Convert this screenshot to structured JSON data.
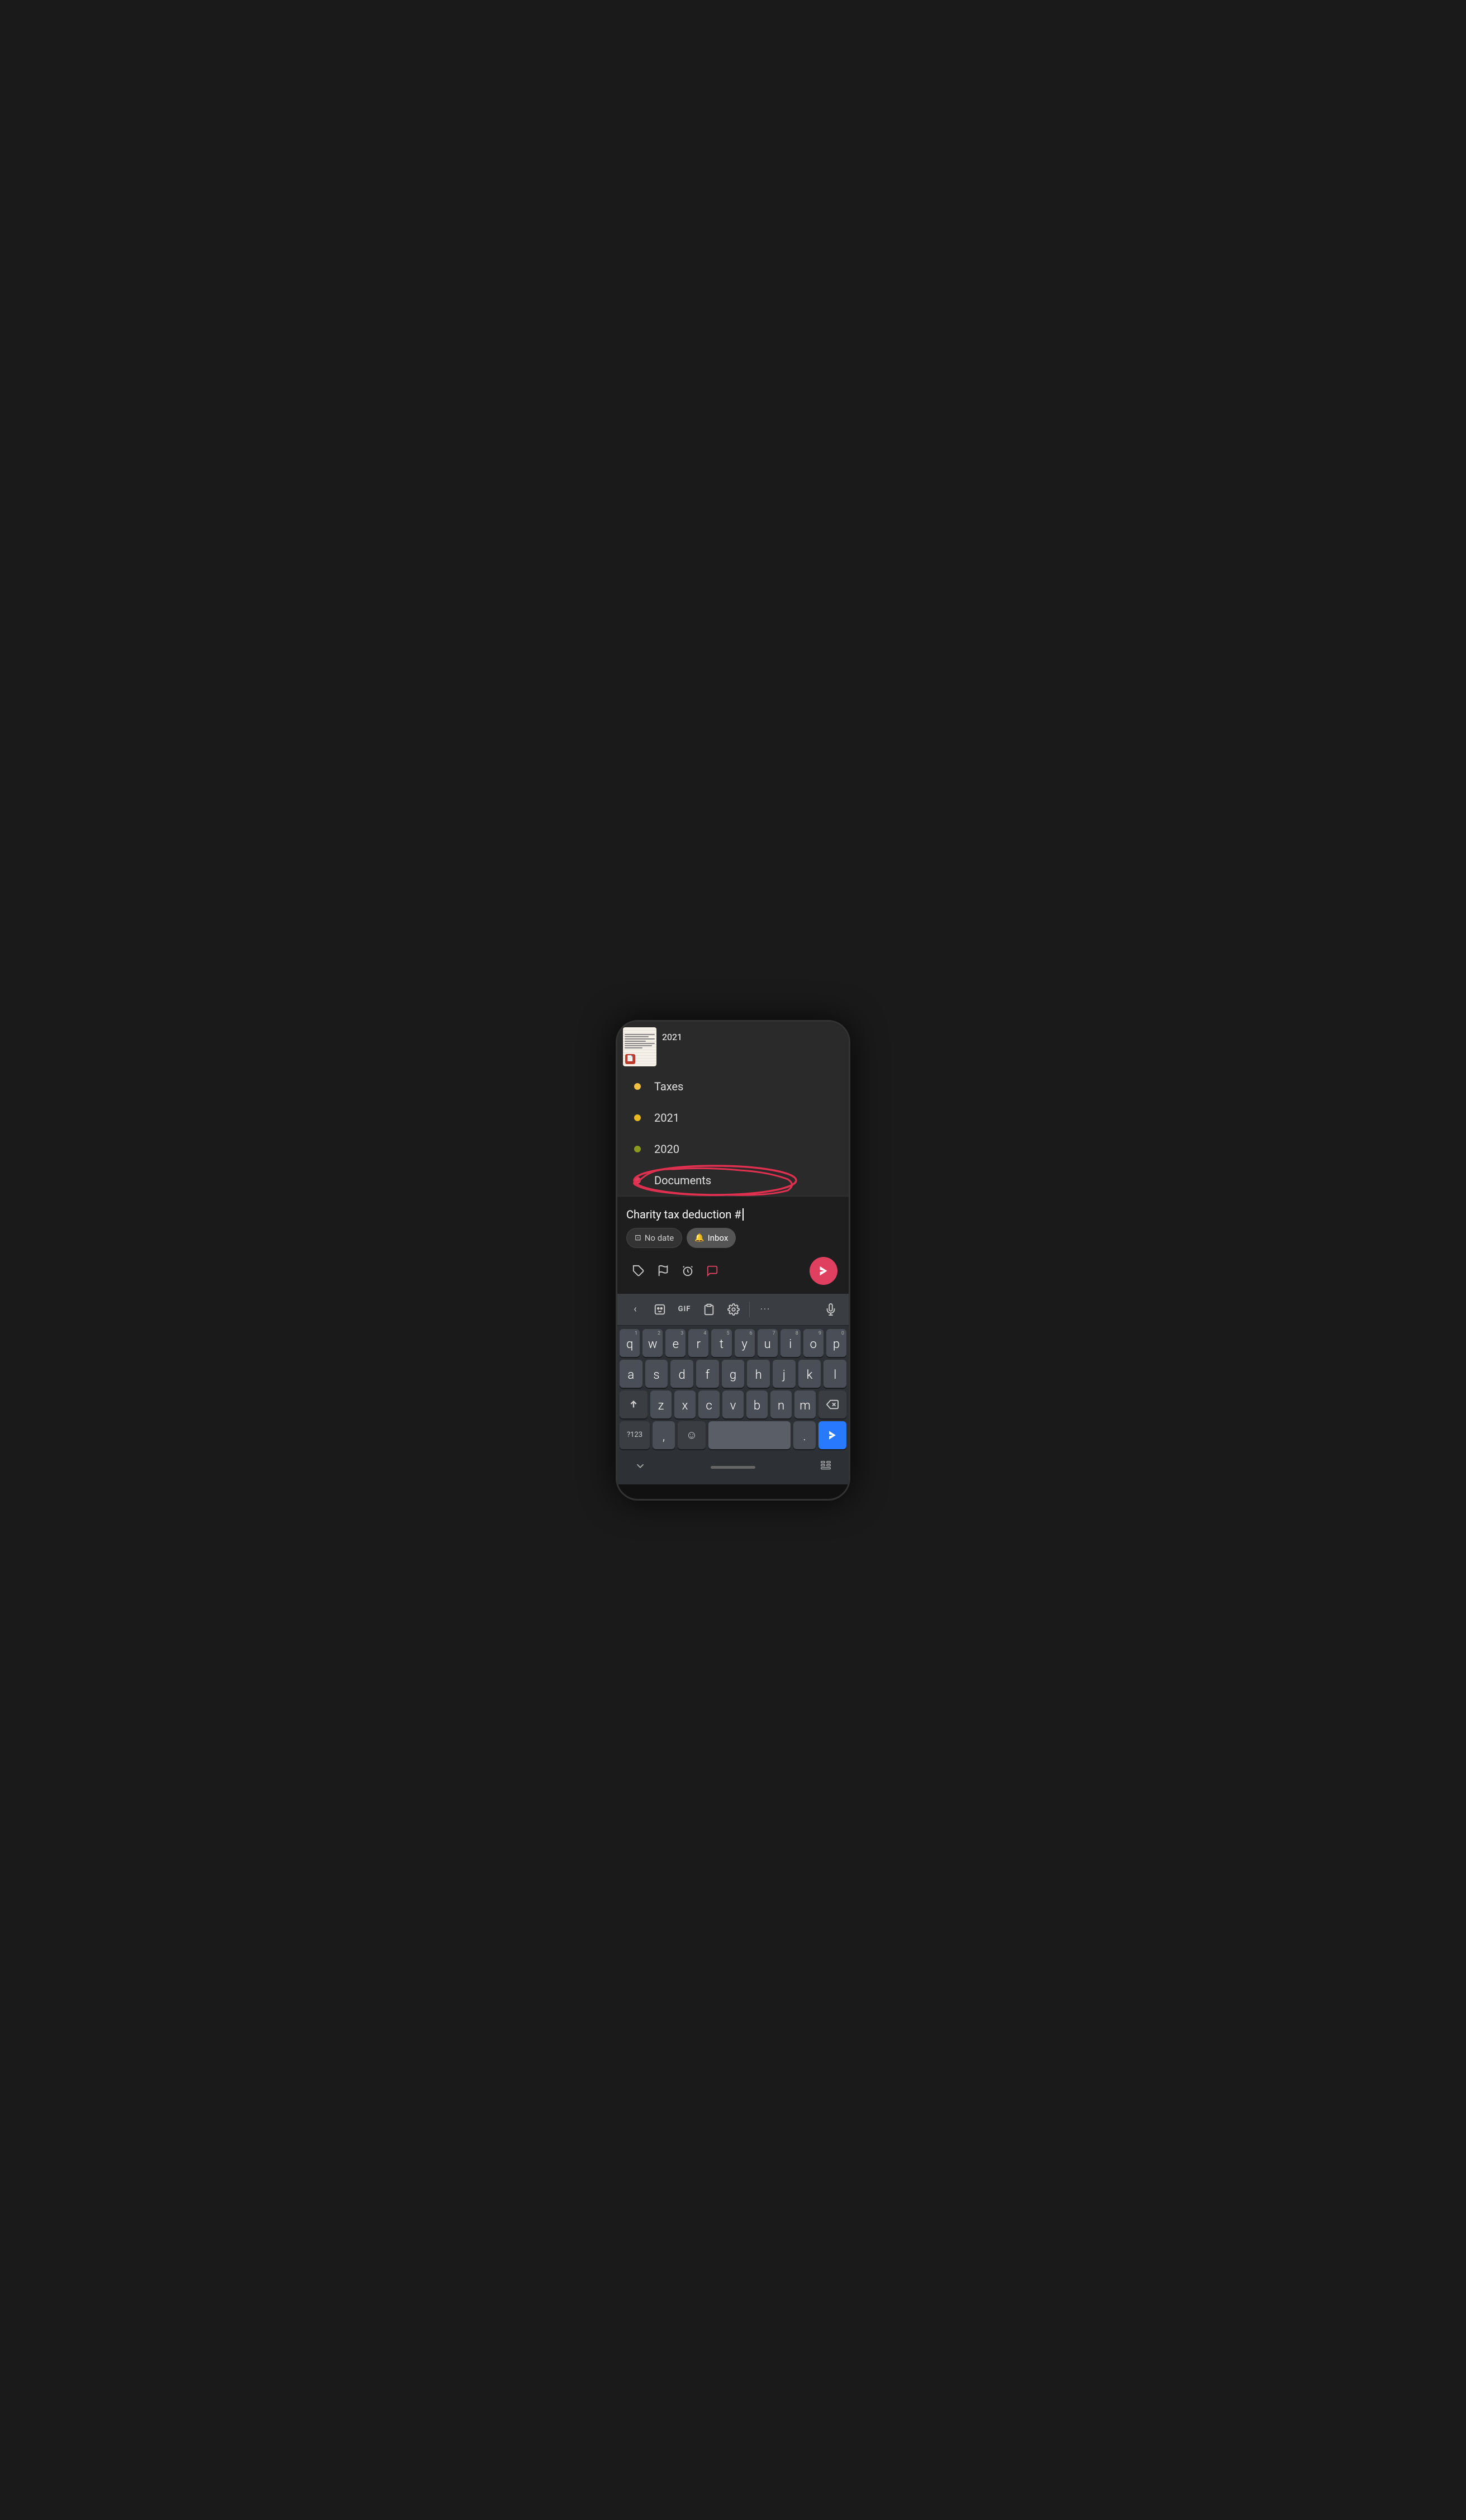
{
  "menu": {
    "items": [
      {
        "id": "taxes",
        "label": "Taxes",
        "dot_color": "yellow"
      },
      {
        "id": "2021",
        "label": "2021",
        "dot_color": "yellow2"
      },
      {
        "id": "2020",
        "label": "2020",
        "dot_color": "olive"
      },
      {
        "id": "documents",
        "label": "Documents",
        "dot_color": "red",
        "circled": true
      }
    ]
  },
  "task_input": {
    "text": "Charity tax deduction #",
    "cursor_visible": true
  },
  "chips": {
    "date_label": "No date",
    "inbox_label": "Inbox"
  },
  "toolbar": {
    "label_label": "label-icon",
    "flag_label": "flag-icon",
    "reminder_label": "reminder-icon",
    "comment_label": "comment-icon",
    "send_label": "send-icon"
  },
  "keyboard_toolbar": {
    "back_label": "<",
    "emoji_label": "emoji-keyboard-icon",
    "gif_label": "GIF",
    "clipboard_label": "clipboard-icon",
    "settings_label": "settings-icon",
    "more_label": "...",
    "mic_label": "mic-icon"
  },
  "keyboard": {
    "rows": [
      {
        "keys": [
          {
            "letter": "q",
            "number": "1"
          },
          {
            "letter": "w",
            "number": "2"
          },
          {
            "letter": "e",
            "number": "3"
          },
          {
            "letter": "r",
            "number": "4"
          },
          {
            "letter": "t",
            "number": "5"
          },
          {
            "letter": "y",
            "number": "6"
          },
          {
            "letter": "u",
            "number": "7"
          },
          {
            "letter": "i",
            "number": "8"
          },
          {
            "letter": "o",
            "number": "9"
          },
          {
            "letter": "p",
            "number": "0"
          }
        ]
      },
      {
        "keys": [
          {
            "letter": "a"
          },
          {
            "letter": "s"
          },
          {
            "letter": "d"
          },
          {
            "letter": "f"
          },
          {
            "letter": "g"
          },
          {
            "letter": "h"
          },
          {
            "letter": "j"
          },
          {
            "letter": "k"
          },
          {
            "letter": "l"
          }
        ]
      },
      {
        "keys": [
          {
            "letter": "⇧",
            "special": true
          },
          {
            "letter": "z"
          },
          {
            "letter": "x"
          },
          {
            "letter": "c"
          },
          {
            "letter": "v"
          },
          {
            "letter": "b"
          },
          {
            "letter": "n"
          },
          {
            "letter": "m"
          },
          {
            "letter": "⌫",
            "special": true
          }
        ]
      },
      {
        "keys": [
          {
            "letter": "?123",
            "special": true
          },
          {
            "letter": ","
          },
          {
            "letter": "☺",
            "special": true
          },
          {
            "letter": " ",
            "space": true
          },
          {
            "letter": ".",
            "special_small": true
          },
          {
            "letter": "▶",
            "send_blue": true
          }
        ]
      }
    ]
  },
  "bottom_bar": {
    "back_icon": "chevron-down",
    "home_pill": "",
    "grid_icon": "grid"
  },
  "thumbnail": {
    "label": "2021"
  }
}
